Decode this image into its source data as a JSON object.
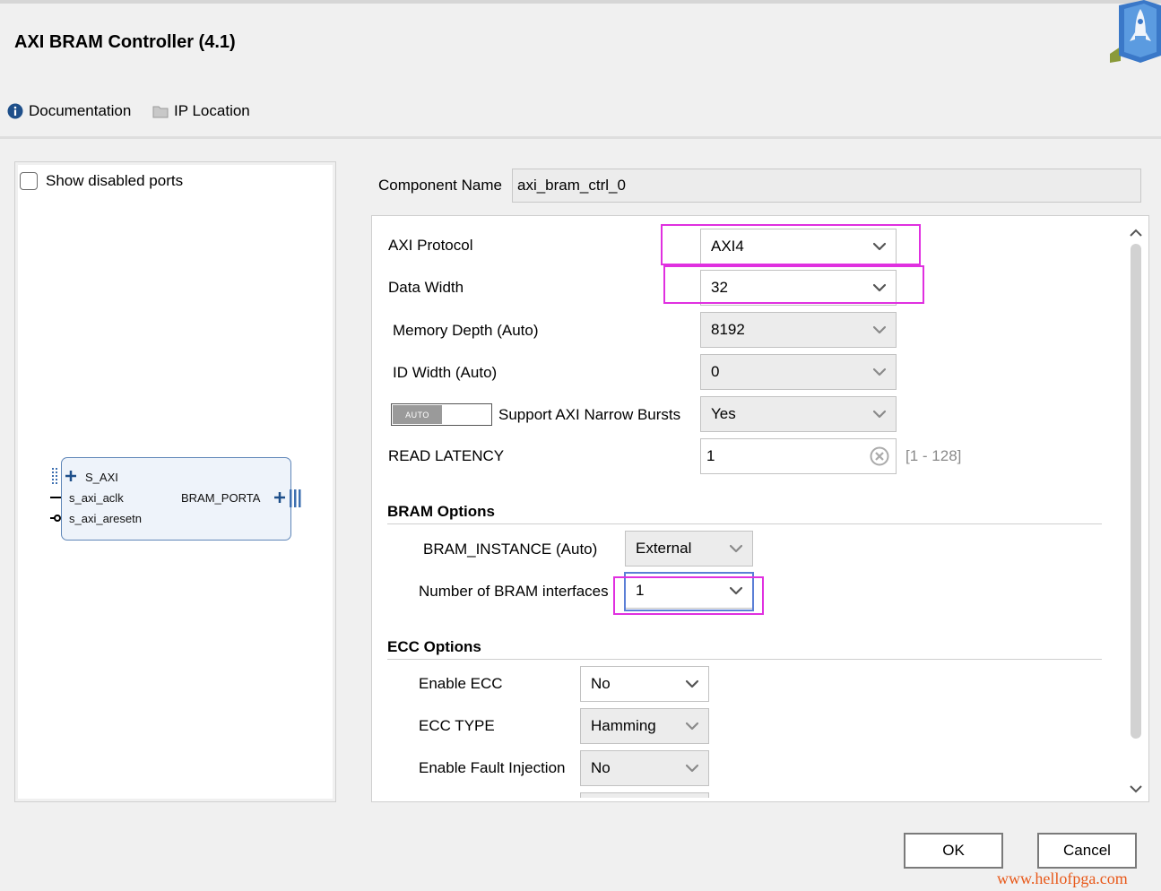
{
  "window": {
    "title": "AXI BRAM Controller (4.1)"
  },
  "toolbar": {
    "documentation": "Documentation",
    "ip_location": "IP Location"
  },
  "left_panel": {
    "show_disabled_ports": "Show disabled ports",
    "block": {
      "ports_left": [
        "S_AXI",
        "s_axi_aclk",
        "s_axi_aresetn"
      ],
      "port_right": "BRAM_PORTA"
    }
  },
  "component": {
    "label": "Component Name",
    "value": "axi_bram_ctrl_0"
  },
  "params": {
    "axi_protocol": {
      "label": "AXI Protocol",
      "value": "AXI4"
    },
    "data_width": {
      "label": "Data Width",
      "value": "32"
    },
    "memory_depth": {
      "label": "Memory Depth (Auto)",
      "value": "8192"
    },
    "id_width": {
      "label": "ID Width (Auto)",
      "value": "0"
    },
    "narrow_bursts": {
      "toggle": "AUTO",
      "label": "Support AXI Narrow Bursts",
      "value": "Yes"
    },
    "read_latency": {
      "label": "READ LATENCY",
      "value": "1",
      "range": "[1 - 128]"
    }
  },
  "bram_options": {
    "title": "BRAM Options",
    "instance": {
      "label": "BRAM_INSTANCE (Auto)",
      "value": "External"
    },
    "interfaces": {
      "label": "Number of BRAM interfaces",
      "value": "1"
    }
  },
  "ecc_options": {
    "title": "ECC Options",
    "enable_ecc": {
      "label": "Enable ECC",
      "value": "No"
    },
    "ecc_type": {
      "label": "ECC TYPE",
      "value": "Hamming"
    },
    "fault_injection": {
      "label": "Enable Fault Injection",
      "value": "No"
    }
  },
  "buttons": {
    "ok": "OK",
    "cancel": "Cancel"
  },
  "watermark": "www.hellofpga.com",
  "colors": {
    "highlight_pink": "#e030e0",
    "highlight_blue": "#5b7fd6",
    "watermark": "#e8591a"
  }
}
